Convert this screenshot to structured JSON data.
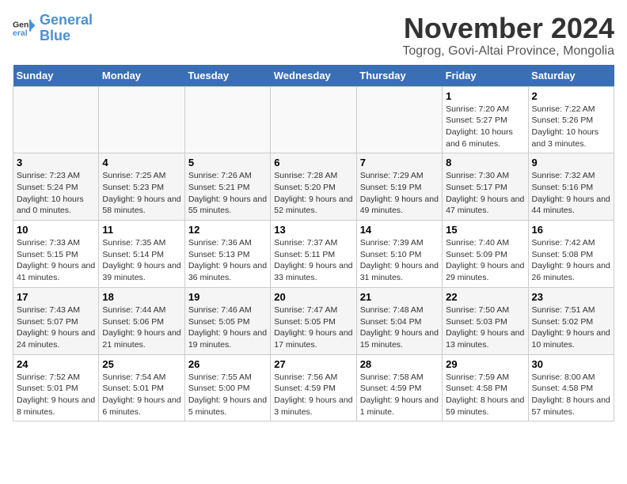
{
  "logo": {
    "text_general": "General",
    "text_blue": "Blue"
  },
  "title": "November 2024",
  "location": "Togrog, Govi-Altai Province, Mongolia",
  "days_of_week": [
    "Sunday",
    "Monday",
    "Tuesday",
    "Wednesday",
    "Thursday",
    "Friday",
    "Saturday"
  ],
  "weeks": [
    [
      {
        "day": "",
        "info": ""
      },
      {
        "day": "",
        "info": ""
      },
      {
        "day": "",
        "info": ""
      },
      {
        "day": "",
        "info": ""
      },
      {
        "day": "",
        "info": ""
      },
      {
        "day": "1",
        "info": "Sunrise: 7:20 AM\nSunset: 5:27 PM\nDaylight: 10 hours and 6 minutes."
      },
      {
        "day": "2",
        "info": "Sunrise: 7:22 AM\nSunset: 5:26 PM\nDaylight: 10 hours and 3 minutes."
      }
    ],
    [
      {
        "day": "3",
        "info": "Sunrise: 7:23 AM\nSunset: 5:24 PM\nDaylight: 10 hours and 0 minutes."
      },
      {
        "day": "4",
        "info": "Sunrise: 7:25 AM\nSunset: 5:23 PM\nDaylight: 9 hours and 58 minutes."
      },
      {
        "day": "5",
        "info": "Sunrise: 7:26 AM\nSunset: 5:21 PM\nDaylight: 9 hours and 55 minutes."
      },
      {
        "day": "6",
        "info": "Sunrise: 7:28 AM\nSunset: 5:20 PM\nDaylight: 9 hours and 52 minutes."
      },
      {
        "day": "7",
        "info": "Sunrise: 7:29 AM\nSunset: 5:19 PM\nDaylight: 9 hours and 49 minutes."
      },
      {
        "day": "8",
        "info": "Sunrise: 7:30 AM\nSunset: 5:17 PM\nDaylight: 9 hours and 47 minutes."
      },
      {
        "day": "9",
        "info": "Sunrise: 7:32 AM\nSunset: 5:16 PM\nDaylight: 9 hours and 44 minutes."
      }
    ],
    [
      {
        "day": "10",
        "info": "Sunrise: 7:33 AM\nSunset: 5:15 PM\nDaylight: 9 hours and 41 minutes."
      },
      {
        "day": "11",
        "info": "Sunrise: 7:35 AM\nSunset: 5:14 PM\nDaylight: 9 hours and 39 minutes."
      },
      {
        "day": "12",
        "info": "Sunrise: 7:36 AM\nSunset: 5:13 PM\nDaylight: 9 hours and 36 minutes."
      },
      {
        "day": "13",
        "info": "Sunrise: 7:37 AM\nSunset: 5:11 PM\nDaylight: 9 hours and 33 minutes."
      },
      {
        "day": "14",
        "info": "Sunrise: 7:39 AM\nSunset: 5:10 PM\nDaylight: 9 hours and 31 minutes."
      },
      {
        "day": "15",
        "info": "Sunrise: 7:40 AM\nSunset: 5:09 PM\nDaylight: 9 hours and 29 minutes."
      },
      {
        "day": "16",
        "info": "Sunrise: 7:42 AM\nSunset: 5:08 PM\nDaylight: 9 hours and 26 minutes."
      }
    ],
    [
      {
        "day": "17",
        "info": "Sunrise: 7:43 AM\nSunset: 5:07 PM\nDaylight: 9 hours and 24 minutes."
      },
      {
        "day": "18",
        "info": "Sunrise: 7:44 AM\nSunset: 5:06 PM\nDaylight: 9 hours and 21 minutes."
      },
      {
        "day": "19",
        "info": "Sunrise: 7:46 AM\nSunset: 5:05 PM\nDaylight: 9 hours and 19 minutes."
      },
      {
        "day": "20",
        "info": "Sunrise: 7:47 AM\nSunset: 5:05 PM\nDaylight: 9 hours and 17 minutes."
      },
      {
        "day": "21",
        "info": "Sunrise: 7:48 AM\nSunset: 5:04 PM\nDaylight: 9 hours and 15 minutes."
      },
      {
        "day": "22",
        "info": "Sunrise: 7:50 AM\nSunset: 5:03 PM\nDaylight: 9 hours and 13 minutes."
      },
      {
        "day": "23",
        "info": "Sunrise: 7:51 AM\nSunset: 5:02 PM\nDaylight: 9 hours and 10 minutes."
      }
    ],
    [
      {
        "day": "24",
        "info": "Sunrise: 7:52 AM\nSunset: 5:01 PM\nDaylight: 9 hours and 8 minutes."
      },
      {
        "day": "25",
        "info": "Sunrise: 7:54 AM\nSunset: 5:01 PM\nDaylight: 9 hours and 6 minutes."
      },
      {
        "day": "26",
        "info": "Sunrise: 7:55 AM\nSunset: 5:00 PM\nDaylight: 9 hours and 5 minutes."
      },
      {
        "day": "27",
        "info": "Sunrise: 7:56 AM\nSunset: 4:59 PM\nDaylight: 9 hours and 3 minutes."
      },
      {
        "day": "28",
        "info": "Sunrise: 7:58 AM\nSunset: 4:59 PM\nDaylight: 9 hours and 1 minute."
      },
      {
        "day": "29",
        "info": "Sunrise: 7:59 AM\nSunset: 4:58 PM\nDaylight: 8 hours and 59 minutes."
      },
      {
        "day": "30",
        "info": "Sunrise: 8:00 AM\nSunset: 4:58 PM\nDaylight: 8 hours and 57 minutes."
      }
    ]
  ]
}
